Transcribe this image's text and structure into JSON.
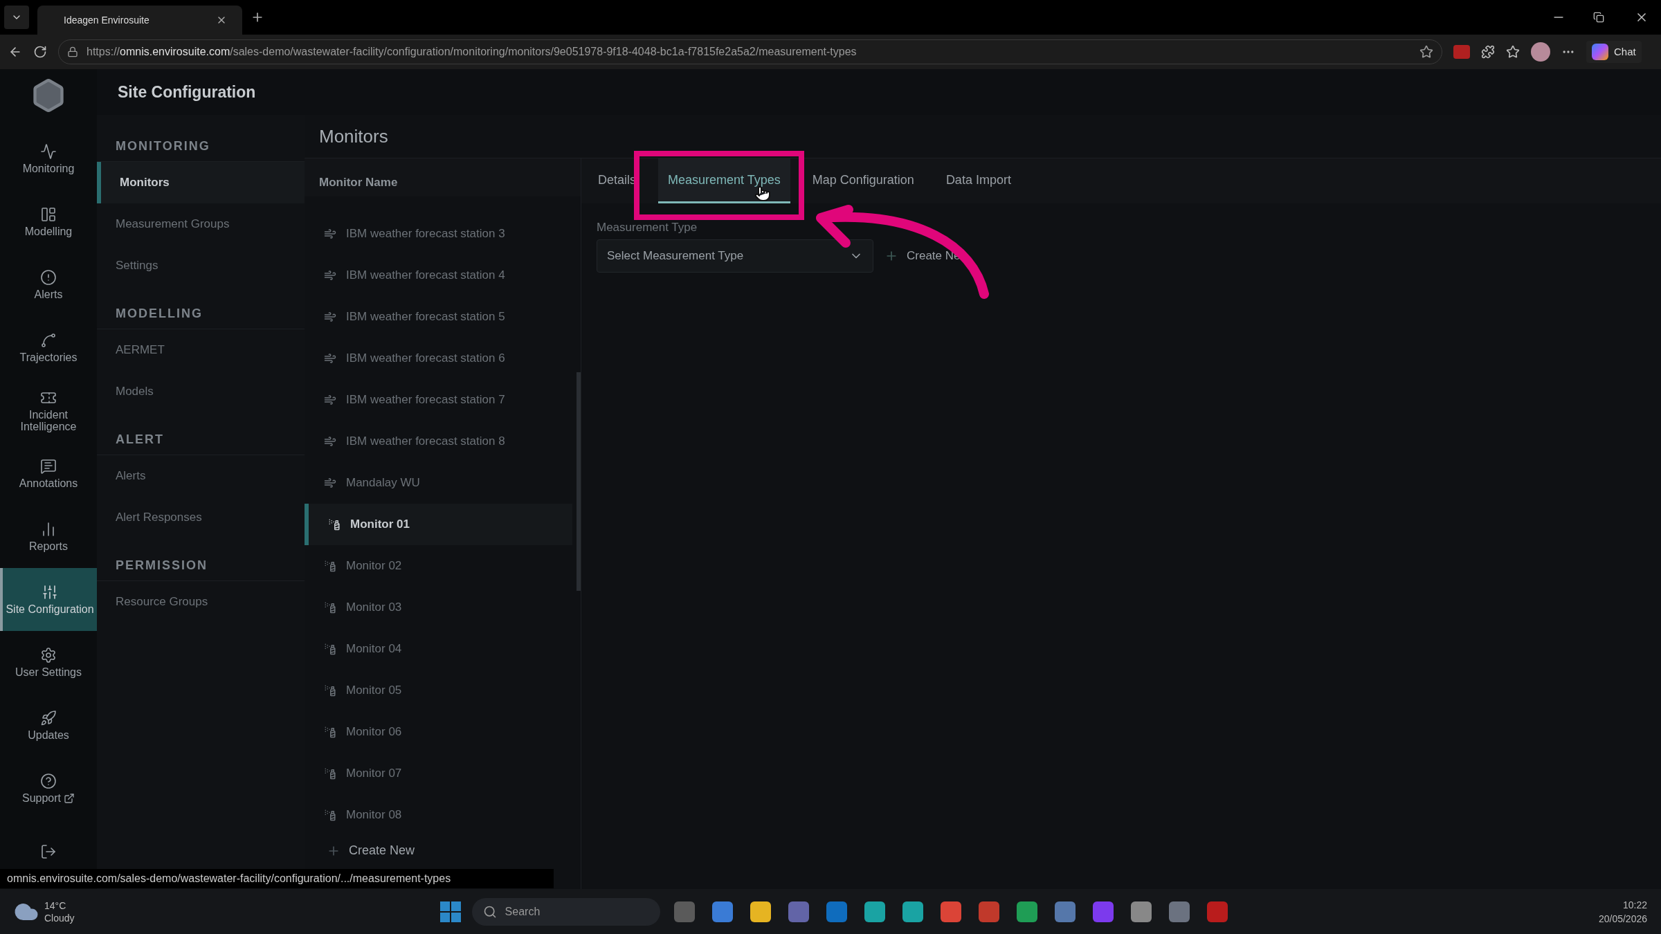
{
  "browser": {
    "tab_title": "Ideagen Envirosuite",
    "url_host": "omnis.envirosuite.com",
    "url_path": "/sales-demo/wastewater-facility/configuration/monitoring/monitors/9e051978-9f18-4048-bc1a-f7815fe2a5a2/measurement-types",
    "url_scheme": "https://",
    "chat": "Chat",
    "status_url": "omnis.envirosuite.com/sales-demo/wastewater-facility/configuration/.../measurement-types"
  },
  "app": {
    "title": "Site Configuration"
  },
  "nav_rail": [
    {
      "kind": "monitoring",
      "label": "Monitoring",
      "selected": false
    },
    {
      "kind": "modelling",
      "label": "Modelling",
      "selected": false
    },
    {
      "kind": "alerts",
      "label": "Alerts",
      "selected": false
    },
    {
      "kind": "trajectories",
      "label": "Trajectories",
      "selected": false
    },
    {
      "kind": "incident",
      "label": "Incident Intelligence",
      "selected": false
    },
    {
      "kind": "annotations",
      "label": "Annotations",
      "selected": false
    },
    {
      "kind": "reports",
      "label": "Reports",
      "selected": false
    },
    {
      "kind": "site",
      "label": "Site Configuration",
      "selected": true
    },
    {
      "kind": "settings",
      "label": "User Settings",
      "selected": false
    },
    {
      "kind": "updates",
      "label": "Updates",
      "selected": false
    },
    {
      "kind": "support",
      "label": "Support",
      "selected": false
    },
    {
      "kind": "logout",
      "selected": false
    }
  ],
  "sections": [
    {
      "title": "MONITORING",
      "items": [
        {
          "label": "Monitors",
          "selected": true
        },
        {
          "label": "Measurement Groups",
          "selected": false
        },
        {
          "label": "Settings",
          "selected": false
        }
      ]
    },
    {
      "title": "MODELLING",
      "items": [
        {
          "label": "AERMET",
          "selected": false
        },
        {
          "label": "Models",
          "selected": false
        }
      ]
    },
    {
      "title": "ALERT",
      "items": [
        {
          "label": "Alerts",
          "selected": false
        },
        {
          "label": "Alert Responses",
          "selected": false
        }
      ]
    },
    {
      "title": "PERMISSION",
      "items": [
        {
          "label": "Resource Groups",
          "selected": false
        }
      ]
    }
  ],
  "monitors": {
    "title": "Monitors",
    "column": "Monitor Name",
    "rows": [
      {
        "kind": "weather",
        "name": "IBM weather forecast station 3",
        "selected": false
      },
      {
        "kind": "weather",
        "name": "IBM weather forecast station 4",
        "selected": false
      },
      {
        "kind": "weather",
        "name": "IBM weather forecast station 5",
        "selected": false
      },
      {
        "kind": "weather",
        "name": "IBM weather forecast station 6",
        "selected": false
      },
      {
        "kind": "weather",
        "name": "IBM weather forecast station 7",
        "selected": false
      },
      {
        "kind": "weather",
        "name": "IBM weather forecast station 8",
        "selected": false
      },
      {
        "kind": "weather",
        "name": "Mandalay WU",
        "selected": false
      },
      {
        "kind": "monitor",
        "name": "Monitor 01",
        "selected": true
      },
      {
        "kind": "monitor",
        "name": "Monitor 02",
        "selected": false
      },
      {
        "kind": "monitor",
        "name": "Monitor 03",
        "selected": false
      },
      {
        "kind": "monitor",
        "name": "Monitor 04",
        "selected": false
      },
      {
        "kind": "monitor",
        "name": "Monitor 05",
        "selected": false
      },
      {
        "kind": "monitor",
        "name": "Monitor 06",
        "selected": false
      },
      {
        "kind": "monitor",
        "name": "Monitor 07",
        "selected": false
      },
      {
        "kind": "monitor",
        "name": "Monitor 08",
        "selected": false
      }
    ],
    "create": "Create New"
  },
  "tabs": [
    {
      "label": "Details",
      "selected": false
    },
    {
      "label": "Measurement Types",
      "selected": true
    },
    {
      "label": "Map Configuration",
      "selected": false
    },
    {
      "label": "Data Import",
      "selected": false
    }
  ],
  "measurement_type": {
    "label": "Measurement Type",
    "placeholder": "Select Measurement Type",
    "create": "Create Ne"
  },
  "taskbar": {
    "temperature": "14°C",
    "weather": "Cloudy",
    "search": "Search",
    "time": "10:22",
    "date": "20/05/2026"
  }
}
